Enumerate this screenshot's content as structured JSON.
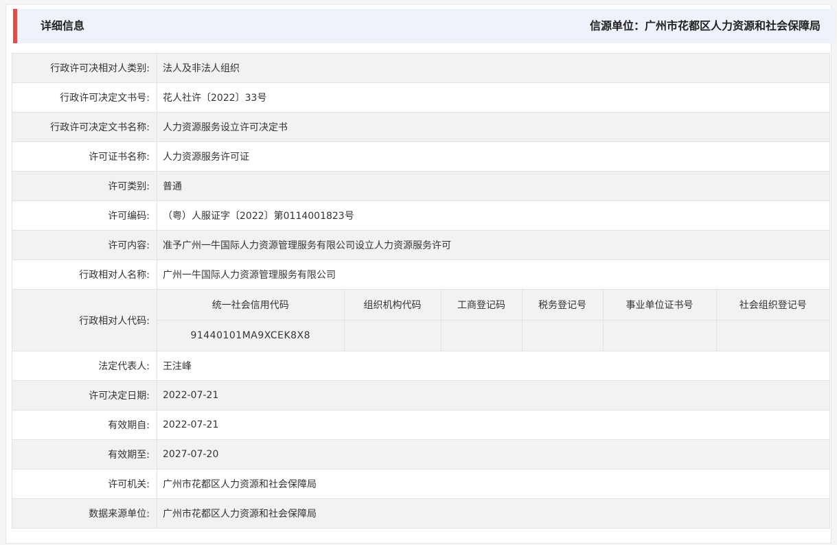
{
  "header": {
    "title": "详细信息",
    "source": "信源单位：广州市花都区人力资源和社会保障局",
    "accent_color": "#e64b4b"
  },
  "rows": [
    {
      "label": "行政许可决相对人类别:",
      "value": "法人及非法人组织"
    },
    {
      "label": "行政许可决定文书号:",
      "value": "花人社许〔2022〕33号"
    },
    {
      "label": "行政许可决定文书名称:",
      "value": "人力资源服务设立许可决定书"
    },
    {
      "label": "许可证书名称:",
      "value": "人力资源服务许可证"
    },
    {
      "label": "许可类别:",
      "value": "普通"
    },
    {
      "label": "许可编码:",
      "value": "（粤）人服证字〔2022〕第0114001823号"
    },
    {
      "label": "许可内容:",
      "value": "准予广州一牛国际人力资源管理服务有限公司设立人力资源服务许可"
    },
    {
      "label": "行政相对人名称:",
      "value": "广州一牛国际人力资源管理服务有限公司"
    }
  ],
  "codes": {
    "label": "行政相对人代码:",
    "headers": [
      "统一社会信用代码",
      "组织机构代码",
      "工商登记码",
      "税务登记号",
      "事业单位证书号",
      "社会组织登记号"
    ],
    "values": [
      "91440101MA9XCEK8X8",
      "",
      "",
      "",
      "",
      ""
    ]
  },
  "rows_after": [
    {
      "label": "法定代表人:",
      "value": "王注峰"
    },
    {
      "label": "许可决定日期:",
      "value": "2022-07-21"
    },
    {
      "label": "有效期自:",
      "value": "2022-07-21"
    },
    {
      "label": "有效期至:",
      "value": "2027-07-20"
    },
    {
      "label": "许可机关:",
      "value": "广州市花都区人力资源和社会保障局"
    },
    {
      "label": "数据来源单位:",
      "value": "广州市花都区人力资源和社会保障局"
    }
  ]
}
